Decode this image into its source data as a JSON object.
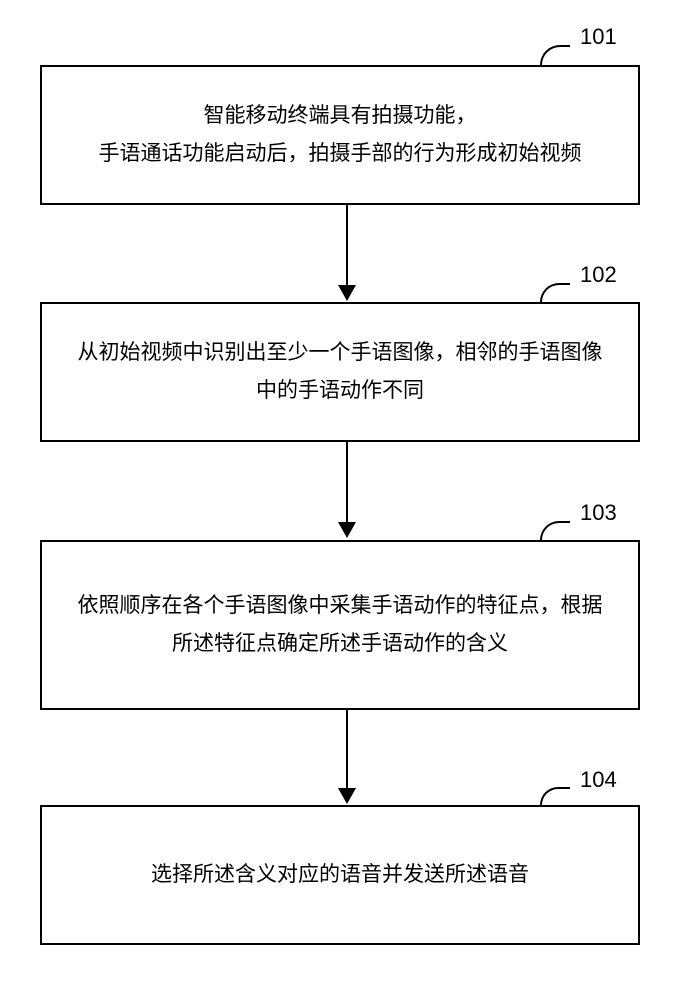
{
  "flowchart": {
    "steps": [
      {
        "label": "101",
        "text": "智能移动终端具有拍摄功能，\n手语通话功能启动后，拍摄手部的行为形成初始视频"
      },
      {
        "label": "102",
        "text": "从初始视频中识别出至少一个手语图像，相邻的手语图像中的手语动作不同"
      },
      {
        "label": "103",
        "text": "依照顺序在各个手语图像中采集手语动作的特征点，根据所述特征点确定所述手语动作的含义"
      },
      {
        "label": "104",
        "text": "选择所述含义对应的语音并发送所述语音"
      }
    ]
  }
}
